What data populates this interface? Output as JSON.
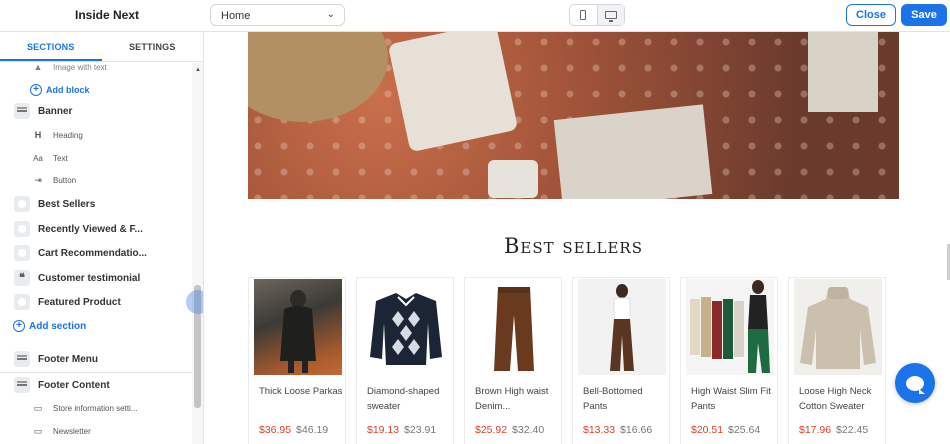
{
  "app": {
    "title": "Inside Next"
  },
  "page_select": {
    "value": "Home"
  },
  "actions": {
    "close": "Close",
    "save": "Save"
  },
  "sidebar": {
    "tabs": [
      "SECTIONS",
      "SETTINGS"
    ],
    "items": [
      {
        "label": "Image with text",
        "kind": "child",
        "icon": "image-icon"
      },
      {
        "label": "Add block",
        "kind": "add",
        "icon": "plus-icon"
      },
      {
        "label": "Banner",
        "kind": "section",
        "icon": "banner-icon"
      },
      {
        "label": "Heading",
        "kind": "child",
        "icon": "heading-icon",
        "glyph": "H"
      },
      {
        "label": "Text",
        "kind": "child",
        "icon": "text-icon",
        "glyph": "Aa"
      },
      {
        "label": "Button",
        "kind": "child",
        "icon": "button-icon",
        "glyph": "⇥"
      },
      {
        "label": "Best Sellers",
        "kind": "section",
        "icon": "collection-icon"
      },
      {
        "label": "Recently Viewed & F...",
        "kind": "section",
        "icon": "collection-icon"
      },
      {
        "label": "Cart Recommendatio...",
        "kind": "section",
        "icon": "collection-icon"
      },
      {
        "label": "Customer testimonial",
        "kind": "section",
        "icon": "quote-icon",
        "glyph": "❝"
      },
      {
        "label": "Featured Product",
        "kind": "section",
        "icon": "product-icon"
      },
      {
        "label": "Add section",
        "kind": "addsec",
        "icon": "plus-icon"
      },
      {
        "label": "Footer Menu",
        "kind": "section",
        "icon": "footer-icon"
      },
      {
        "label": "Footer Content",
        "kind": "section",
        "icon": "footer-icon"
      },
      {
        "label": "Store information setti...",
        "kind": "child",
        "icon": "block-icon"
      },
      {
        "label": "Newsletter",
        "kind": "child",
        "icon": "block-icon"
      }
    ]
  },
  "preview": {
    "section_title": "Best sellers",
    "products": [
      {
        "name": "Thick Loose Parkas",
        "sale": "$36.95",
        "original": "$46.19"
      },
      {
        "name": "Diamond-shaped sweater",
        "sale": "$19.13",
        "original": "$23.91"
      },
      {
        "name": "Brown High waist Denim...",
        "sale": "$25.92",
        "original": "$32.40"
      },
      {
        "name": "Bell-Bottomed Pants",
        "sale": "$13.33",
        "original": "$16.66"
      },
      {
        "name": "High Waist Slim Fit Pants",
        "sale": "$20.51",
        "original": "$25.64"
      },
      {
        "name": "Loose High Neck Cotton Sweater",
        "sale": "$17.96",
        "original": "$22.45"
      }
    ]
  },
  "colors": {
    "accent": "#1a73e8",
    "sale_price": "#d9412a"
  }
}
